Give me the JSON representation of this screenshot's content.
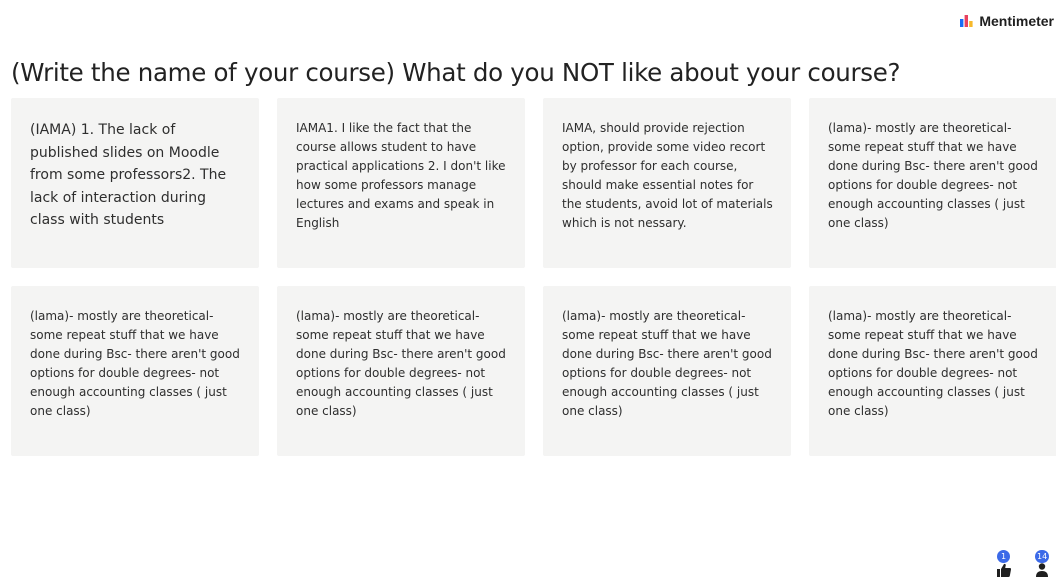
{
  "brand": {
    "name": "Mentimeter",
    "logo_icon": "mentimeter-bars-icon",
    "logo_colors": [
      "#e8415f",
      "#196cf6",
      "#f7b92b"
    ]
  },
  "question": {
    "title": "(Write the name of your course) What do you NOT like about your course?"
  },
  "responses": [
    {
      "text": "(IAMA) 1. The lack of published slides on Moodle from some professors2. The lack of interaction during class with students"
    },
    {
      "text": "IAMA1. I like the fact that the course allows student to have practical applications 2. I don't like how some professors manage lectures and exams and speak in English"
    },
    {
      "text": "IAMA, should provide rejection option, provide some video recort by professor for each course, should make essential notes for the students, avoid lot of materials which is not nessary."
    },
    {
      "text": "(lama)- mostly are theoretical- some repeat stuff that we have done during Bsc- there aren't good options for double degrees- not enough accounting classes ( just one class)"
    },
    {
      "text": "(lama)- mostly are theoretical- some repeat stuff that we have done during Bsc- there aren't good options for double degrees- not enough accounting classes ( just one class)"
    },
    {
      "text": "(lama)- mostly are theoretical- some repeat stuff that we have done during Bsc- there aren't good options for double degrees- not enough accounting classes ( just one class)"
    },
    {
      "text": "(lama)- mostly are theoretical- some repeat stuff that we have done during Bsc- there aren't good options for double degrees- not enough accounting classes ( just one class)"
    },
    {
      "text": "(lama)- mostly are theoretical- some repeat stuff that we have done during Bsc- there aren't good options for double degrees- not enough accounting classes ( just one class)"
    }
  ],
  "footer": {
    "reactions": {
      "count": "1",
      "icon": "thumbs-up-icon"
    },
    "participants": {
      "count": "14",
      "icon": "person-icon"
    },
    "badge_color": "#3c6ae8"
  }
}
